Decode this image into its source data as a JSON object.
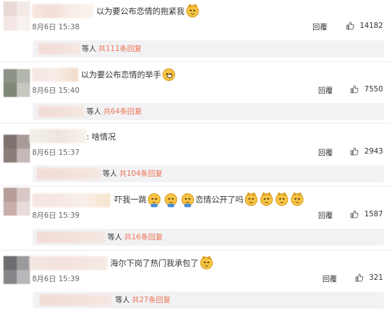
{
  "comments": [
    {
      "text": "以为要公布恋情的抱紧我",
      "time": "8月6日 15:38",
      "reply_label": "回覆",
      "likes": "14182",
      "thread_waits": "等人",
      "thread_count": "共111条回复",
      "avatar_colors": [
        "#e8d8d6",
        "#f3e9e5",
        "#f4e6e4",
        "#f8f2ef"
      ],
      "emojis": [
        "cat-face-icon"
      ]
    },
    {
      "text": "以为要公布恋情的举手",
      "time": "8月6日 15:40",
      "reply_label": "回覆",
      "likes": "7550",
      "thread_waits": "等人",
      "thread_count": "共64条回复",
      "avatar_colors": [
        "#8d9386",
        "#b4b7ad",
        "#7f8877",
        "#c6c8c0"
      ],
      "emojis": [
        "laugh-face-icon"
      ]
    },
    {
      "text": ": 啥情况",
      "time": "8月6日 15:37",
      "reply_label": "回覆",
      "likes": "2943",
      "thread_waits": "等人",
      "thread_count": "共104条回复",
      "avatar_colors": [
        "#7f7371",
        "#a99b98",
        "#8a7d7a",
        "#c4b9b6"
      ],
      "emojis": []
    },
    {
      "text": "吓我一跳",
      "text2": "恋情公开了吗",
      "time": "8月6日 15:39",
      "reply_label": "回覆",
      "likes": "1587",
      "thread_waits": "等人",
      "thread_count": "共16条回复",
      "avatar_colors": [
        "#b69d9a",
        "#d9c8c5",
        "#c7aeab",
        "#e7dcda"
      ],
      "emojis": [
        "wave-face-icon",
        "wave-face-icon",
        "wave-face-icon"
      ],
      "emojis2": [
        "cat-face-icon",
        "cat-face-icon",
        "cat-face-icon",
        "cat-face-icon"
      ]
    },
    {
      "text": "海尔下岗了热门我承包了",
      "time": "8月6日 15:39",
      "reply_label": "回覆",
      "likes": "321",
      "thread_waits": "等人",
      "thread_count": "共27条回复",
      "avatar_colors": [
        "#6e6e72",
        "#9a9a9d",
        "#85858a",
        "#b8b8bb"
      ],
      "emojis": [
        "cat-face-icon"
      ]
    }
  ],
  "colors": {
    "accent": "#eb7350",
    "thread_bg": "#f2f2f5"
  }
}
